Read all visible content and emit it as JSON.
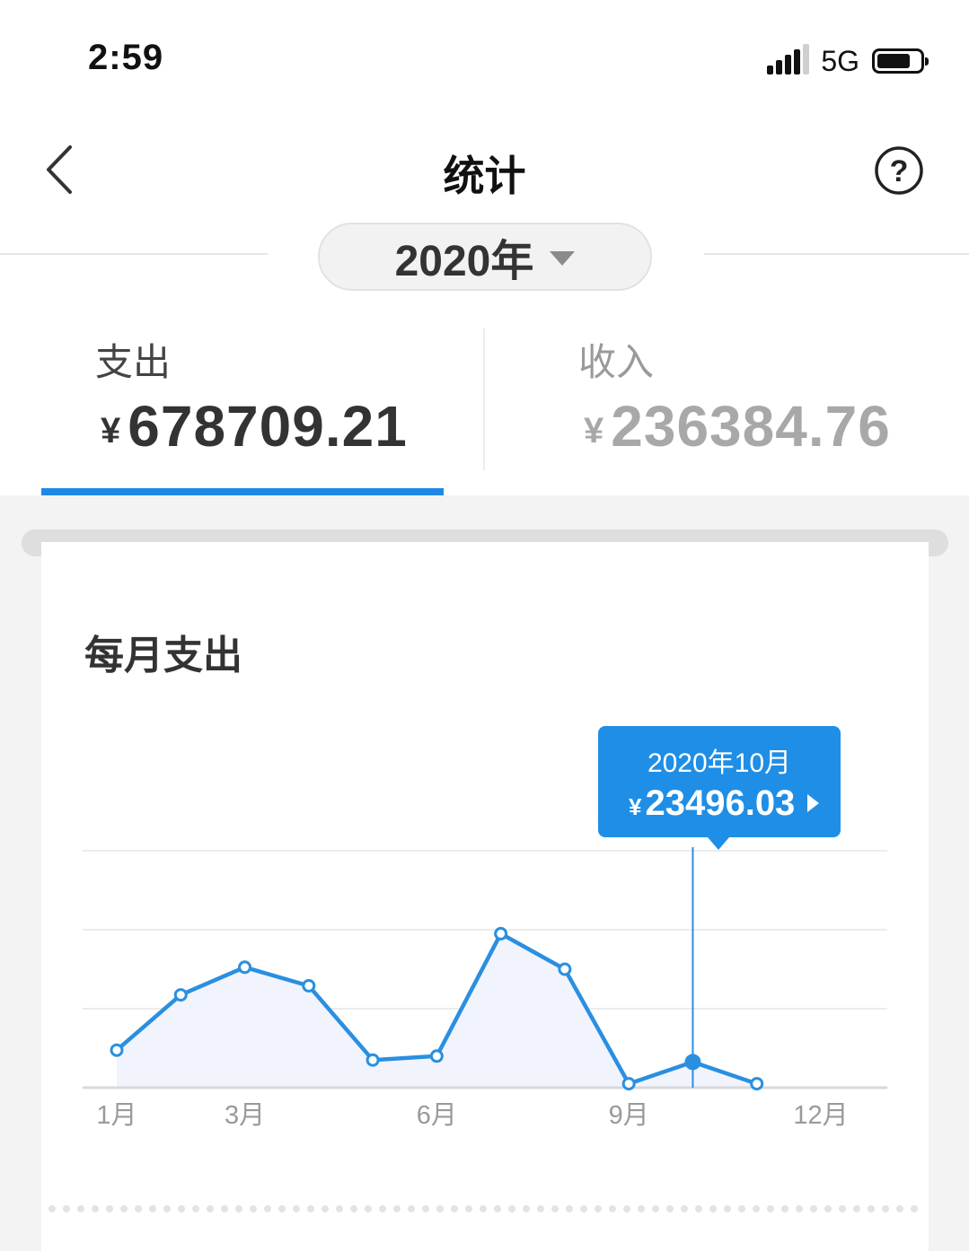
{
  "status_bar": {
    "time": "2:59",
    "network": "5G"
  },
  "nav": {
    "title": "统计",
    "back_icon": "chevron-left-icon",
    "help_icon": "question-circle-icon"
  },
  "year_selector": {
    "label": "2020年"
  },
  "tabs": [
    {
      "label": "支出",
      "currency": "¥",
      "amount": "678709.21",
      "active": true
    },
    {
      "label": "收入",
      "currency": "¥",
      "amount": "236384.76",
      "active": false
    }
  ],
  "colors": {
    "accent": "#1e88e5",
    "line": "#2b8fe0",
    "area": "#f1f4fc",
    "grid": "#ececec"
  },
  "card": {
    "title": "每月支出"
  },
  "tooltip": {
    "date": "2020年10月",
    "currency": "¥",
    "amount": "23496.03"
  },
  "chart_data": {
    "type": "line",
    "x": [
      1,
      2,
      3,
      4,
      5,
      6,
      7,
      8,
      9,
      10,
      11
    ],
    "values": [
      9500,
      23500,
      30500,
      25800,
      7000,
      8000,
      39000,
      30000,
      1000,
      6500,
      1000
    ],
    "highlight": {
      "x": 10,
      "value": 23496.03
    },
    "ylim": [
      0,
      60000
    ],
    "gridlines": [
      0,
      20000,
      40000,
      60000
    ],
    "xlim": [
      1,
      12
    ],
    "x_ticks": [
      {
        "pos": 1,
        "label": "1月"
      },
      {
        "pos": 3,
        "label": "3月"
      },
      {
        "pos": 6,
        "label": "6月"
      },
      {
        "pos": 9,
        "label": "9月"
      },
      {
        "pos": 12,
        "label": "12月"
      }
    ],
    "grid": true
  }
}
